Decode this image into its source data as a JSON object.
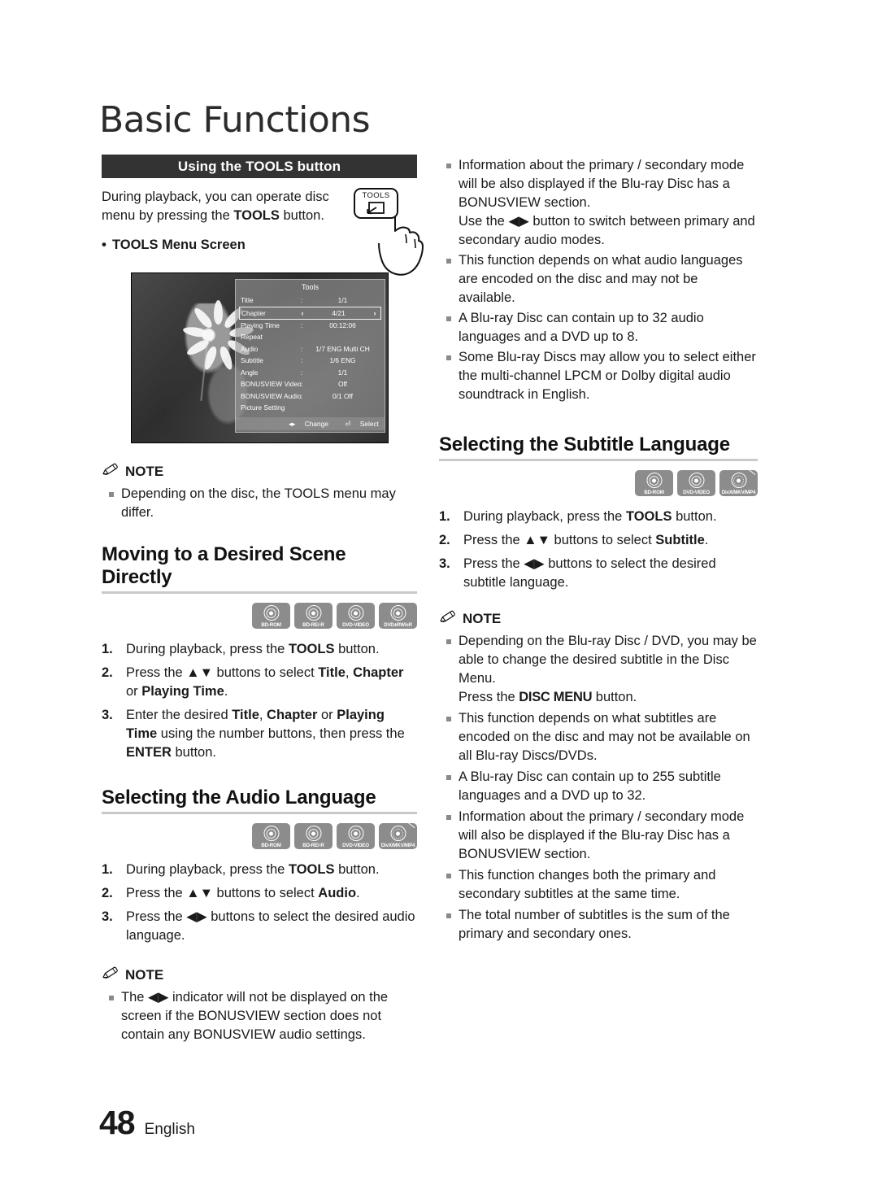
{
  "page": {
    "title": "Basic Functions",
    "number": "48",
    "language": "English"
  },
  "left": {
    "section_bar": {
      "prefix": "Using the ",
      "strong": "TOOLS",
      "suffix": " button"
    },
    "intro": {
      "part1": "During playback, you can operate disc menu by pressing the ",
      "strong": "TOOLS",
      "part2": " button."
    },
    "tools_key_label": "TOOLS",
    "menu_screen_label": "TOOLS Menu Screen",
    "tools_screen": {
      "title": "Tools",
      "rows": [
        {
          "label": "Title",
          "sep": ":",
          "value": "1/1",
          "selected": false
        },
        {
          "label": "Chapter",
          "sep": "",
          "value": "4/21",
          "selected": true,
          "left_arrow": "‹",
          "right_arrow": "›"
        },
        {
          "label": "Playing Time",
          "sep": ":",
          "value": "00:12:06",
          "selected": false
        },
        {
          "label": "Repeat",
          "sep": "",
          "value": "",
          "selected": false
        },
        {
          "label": "Audio",
          "sep": ":",
          "value": "1/7 ENG Multi CH",
          "selected": false
        },
        {
          "label": "Subtitle",
          "sep": ":",
          "value": "1/6 ENG",
          "selected": false
        },
        {
          "label": "Angle",
          "sep": ":",
          "value": "1/1",
          "selected": false
        },
        {
          "label": "BONUSVIEW Video",
          "sep": ":",
          "value": "Off",
          "selected": false
        },
        {
          "label": "BONUSVIEW Audio",
          "sep": ":",
          "value": "0/1 Off",
          "selected": false
        },
        {
          "label": "Picture Setting",
          "sep": "",
          "value": "",
          "selected": false
        }
      ],
      "footer_change": "Change",
      "footer_select": "Select",
      "footer_change_icon": "◂▸",
      "footer_select_icon": "⏎"
    },
    "note1": {
      "title": "NOTE",
      "items": [
        "Depending on the disc, the TOOLS menu may differ."
      ]
    },
    "scene_heading": "Moving to a Desired Scene Directly",
    "scene_badges": [
      "BD-ROM",
      "BD-RE/-R",
      "DVD-VIDEO",
      "DVD±RW/±R"
    ],
    "scene_steps": [
      {
        "num": "1.",
        "html": "During playback, press the <b>TOOLS</b> button."
      },
      {
        "num": "2.",
        "html": "Press the ▲▼ buttons to select <b>Title</b>, <b>Chapter</b> or <b>Playing Time</b>."
      },
      {
        "num": "3.",
        "html": "Enter the desired <b>Title</b>, <b>Chapter</b> or <b>Playing Time</b> using the number buttons, then press the <b>ENTER</b> button."
      }
    ],
    "audio_heading": "Selecting the Audio Language",
    "audio_badges": [
      "BD-ROM",
      "BD-RE/-R",
      "DVD-VIDEO",
      "DivX/MKV/MP4"
    ],
    "audio_steps": [
      {
        "num": "1.",
        "html": "During playback, press the <b>TOOLS</b> button."
      },
      {
        "num": "2.",
        "html": "Press the ▲▼ buttons to select <b>Audio</b>."
      },
      {
        "num": "3.",
        "html": "Press the ◀▶ buttons to select the desired audio language."
      }
    ],
    "note2": {
      "title": "NOTE",
      "items": [
        "The ◀▶ indicator will not be displayed on the screen if the BONUSVIEW section does not contain any BONUSVIEW audio settings."
      ]
    }
  },
  "right": {
    "audio_notes": [
      "Information about the primary / secondary mode will be also displayed if the Blu-ray Disc has a BONUSVIEW section.\nUse the ◀▶ button to switch between primary and secondary audio modes.",
      "This function depends on what audio languages are encoded on the disc and may not be available.",
      "A Blu-ray Disc can contain up to 32 audio languages and a DVD up to 8.",
      "Some Blu-ray Discs may allow you to select either the multi-channel LPCM or Dolby digital audio soundtrack in English."
    ],
    "subtitle_heading": "Selecting the Subtitle Language",
    "subtitle_badges": [
      "BD-ROM",
      "DVD-VIDEO",
      "DivX/MKV/MP4"
    ],
    "subtitle_steps": [
      {
        "num": "1.",
        "html": "During playback, press the <b>TOOLS</b> button."
      },
      {
        "num": "2.",
        "html": "Press the ▲▼ buttons to select <b>Subtitle</b>."
      },
      {
        "num": "3.",
        "html": "Press the ◀▶ buttons to select the desired subtitle language."
      }
    ],
    "note": {
      "title": "NOTE",
      "items_html": [
        "Depending on the Blu-ray Disc / DVD, you may be able to change the desired subtitle in the Disc Menu.<br>Press the <span class=\"cond\">DISC MENU</span> button.",
        "This function depends on what subtitles are encoded on the disc and may not be available on all Blu-ray Discs/DVDs.",
        "A Blu-ray Disc can contain up to 255 subtitle languages and a DVD up to 32.",
        "Information about the primary / secondary mode will also be displayed if the Blu-ray Disc has a BONUSVIEW section.",
        "This function changes both the primary and secondary subtitles at the same time.",
        "The total number of subtitles is the sum of the primary and secondary ones."
      ]
    }
  }
}
